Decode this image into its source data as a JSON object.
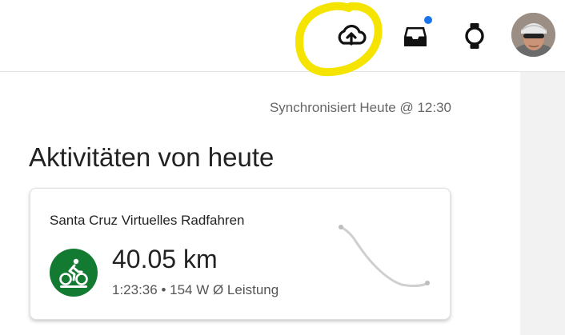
{
  "header": {
    "icons": {
      "upload": "cloud-upload-icon",
      "inbox": "inbox-icon",
      "device": "watch-icon"
    },
    "inbox_badge_color": "#1a73e8",
    "annotation_color": "#f5e400"
  },
  "status": {
    "sync_text": "Synchronisiert Heute @ 12:30"
  },
  "page": {
    "title": "Aktivitäten von heute"
  },
  "activity": {
    "name": "Santa Cruz Virtuelles Radfahren",
    "distance": "40.05 km",
    "details": "1:23:36 • 154 W Ø Leistung",
    "type_icon": "indoor-cycling-icon",
    "icon_color": "#137a31"
  }
}
